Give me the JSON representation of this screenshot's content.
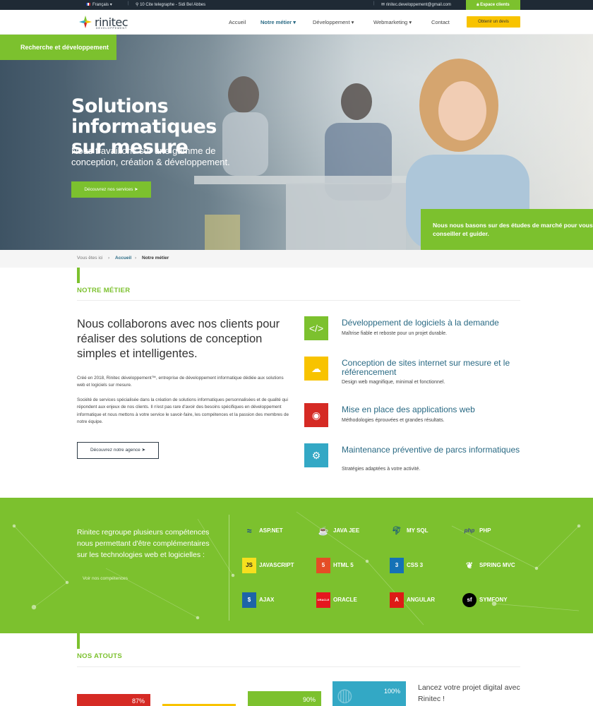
{
  "topbar": {
    "language": "Français",
    "address": "10 Cite telegraphe - Sidi Bel Abbes",
    "email": "rinitec.developpement@gmail.com",
    "espace_clients": "Espace clients"
  },
  "header": {
    "logo_name": "rinitec",
    "logo_sub": "DEVELOPPEMENT",
    "nav": [
      "Accueil",
      "Notre métier",
      "Développement",
      "Webmarketing",
      "Contact"
    ],
    "active_nav": "Notre métier",
    "devis_button": "Obtenir un devis"
  },
  "hero": {
    "tab": "Recherche et développement",
    "title_line1": "Solutions informatiques",
    "title_line2": "sur mesure",
    "subtitle": "Nous travaillons sur une gamme de conception, création & développement.",
    "button": "Découvrez nos services",
    "callout": "Nous nous basons sur des études de marché pour vous conseiller et guider."
  },
  "breadcrumb": {
    "prefix": "Vous êtes ici",
    "home": "Accueil",
    "current": "Notre métier"
  },
  "metier": {
    "section_title": "NOTRE MÉTIER",
    "intro": "Nous collaborons avec nos clients pour réaliser des solutions de conception simples et intelligentes.",
    "para1": "Créé en 2018, Rinitec développement™, entreprise de développement informatique dédiée aux solutions web et logiciels sur mesure.",
    "para2": "Société de services spécialisée dans la création de solutions informatiques personnalisées et de qualité qui répondent aux enjeux de nos clients. Il n'est pas rare d'avoir des besoins spécifiques en développement informatique et nous mettons à votre service le savoir-faire, les compétences et la passion des membres de notre équipe.",
    "button": "Découvrez notre agence",
    "services": [
      {
        "title": "Développement de logiciels à la demande",
        "desc": "Maîtrise fiable et reboste pour un projet durable.",
        "icon": "code-icon",
        "color": "#7cc12e"
      },
      {
        "title": "Conception de sites internet sur mesure et le référencement",
        "desc": "Design web magnifique, minimal et fonctionnel.",
        "icon": "cloud-upload-icon",
        "color": "#f8c300"
      },
      {
        "title": "Mise en place des applications web",
        "desc": "Méthodologies éprouvées et grandes résultats.",
        "icon": "rss-icon",
        "color": "#d52a24"
      },
      {
        "title": "Maintenance préventive de parcs informatiques",
        "desc": "Stratégies adaptées à votre activité.",
        "icon": "gear-icon",
        "color": "#33a8c5"
      }
    ]
  },
  "tech": {
    "text": "Rinitec regroupe plusieurs compétences nous permettant d'être complémentaires sur les technologies web et logicielles :",
    "link": "Voir nos compétences",
    "items": [
      "ASP.NET",
      "JAVA JEE",
      "MY SQL",
      "PHP",
      "JAVASCRIPT",
      "HTML 5",
      "CSS 3",
      "SPRING MVC",
      "AJAX",
      "ORACLE",
      "ANGULAR",
      "SYMFONY"
    ]
  },
  "atouts": {
    "section_title": "NOS ATOUTS",
    "percents": [
      "87%",
      "90%",
      "100%"
    ],
    "launch_text": "Lancez votre projet digital avec Rinitec !"
  }
}
